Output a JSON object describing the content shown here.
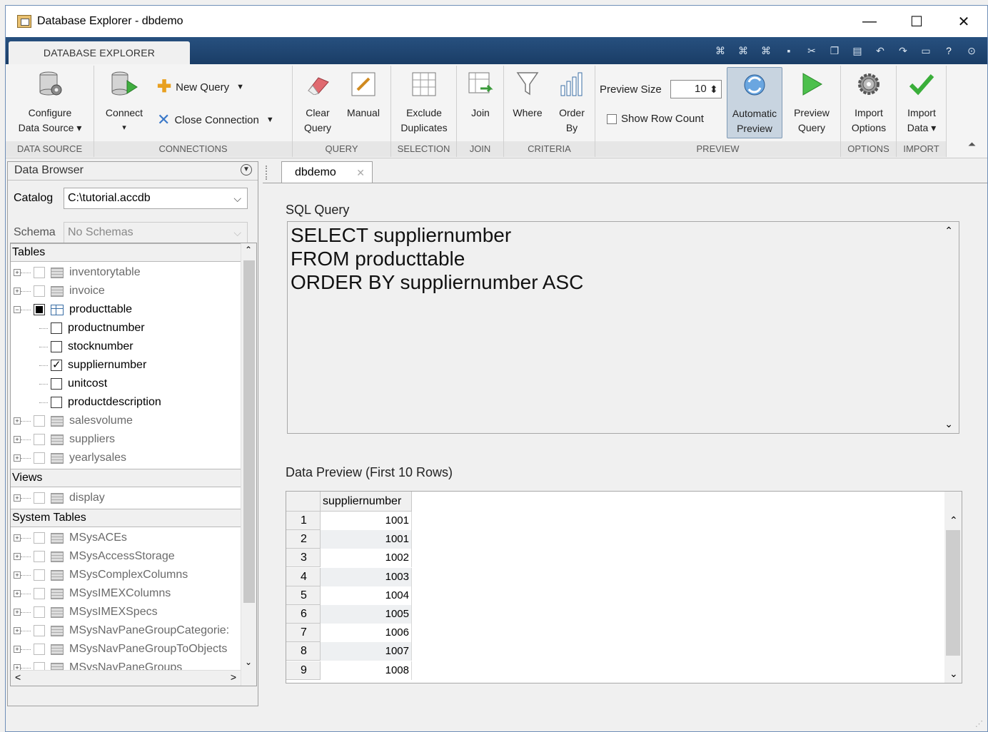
{
  "window": {
    "title": "Database Explorer - dbdemo",
    "controls": [
      "—",
      "☐",
      "✕"
    ]
  },
  "ribbon": {
    "tab": "DATABASE EXPLORER",
    "qat_icons": [
      "pin-icon",
      "pin-icon",
      "pin-icon",
      "save-icon",
      "cut-icon",
      "copy-icon",
      "paste-icon",
      "undo-icon",
      "redo-icon",
      "window-icon",
      "help-icon",
      "minimize-ribbon-icon"
    ],
    "groups": {
      "data_source": "DATA SOURCE",
      "connections": "CONNECTIONS",
      "query": "QUERY",
      "selection": "SELECTION",
      "join": "JOIN",
      "criteria": "CRITERIA",
      "preview": "PREVIEW",
      "options": "OPTIONS",
      "import": "IMPORT"
    },
    "buttons": {
      "configure_1": "Configure",
      "configure_2": "Data Source ▾",
      "connect": "Connect",
      "connect_arrow": "▾",
      "new_query": "New Query",
      "close_connection": "Close Connection",
      "clear_1": "Clear",
      "clear_2": "Query",
      "manual": "Manual",
      "exclude_1": "Exclude",
      "exclude_2": "Duplicates",
      "join": "Join",
      "where": "Where",
      "order_1": "Order",
      "order_2": "By",
      "preview_size_label": "Preview Size",
      "preview_size_value": "10",
      "show_row_count": "Show Row Count",
      "auto_1": "Automatic",
      "auto_2": "Preview",
      "preview_q_1": "Preview",
      "preview_q_2": "Query",
      "import_opts_1": "Import",
      "import_opts_2": "Options",
      "import_data_1": "Import",
      "import_data_2": "Data ▾"
    },
    "accent": "#1f4a78"
  },
  "browser": {
    "title": "Data Browser",
    "catalog_label": "Catalog",
    "catalog_value": "C:\\tutorial.accdb",
    "schema_label": "Schema",
    "schema_value": "No Schemas",
    "sections": {
      "tables": "Tables",
      "views": "Views",
      "system": "System Tables"
    },
    "tables": [
      "inventorytable",
      "invoice",
      "producttable",
      "salesvolume",
      "suppliers",
      "yearlysales"
    ],
    "columns": [
      "productnumber",
      "stocknumber",
      "suppliernumber",
      "unitcost",
      "productdescription"
    ],
    "checked_column": "suppliernumber",
    "views": [
      "display"
    ],
    "system_tables": [
      "MSysACEs",
      "MSysAccessStorage",
      "MSysComplexColumns",
      "MSysIMEXColumns",
      "MSysIMEXSpecs",
      "MSysNavPaneGroupCategorie:",
      "MSysNavPaneGroupToObjects",
      "MSysNavPaneGroups"
    ]
  },
  "doc": {
    "tab": "dbdemo",
    "sql_label": "SQL Query",
    "sql_lines": [
      "SELECT suppliernumber",
      "FROM producttable",
      "ORDER BY suppliernumber ASC"
    ],
    "preview_label": "Data Preview (First 10 Rows)",
    "column": "suppliernumber",
    "rows": [
      [
        "1",
        "1001"
      ],
      [
        "2",
        "1001"
      ],
      [
        "3",
        "1002"
      ],
      [
        "4",
        "1003"
      ],
      [
        "5",
        "1004"
      ],
      [
        "6",
        "1005"
      ],
      [
        "7",
        "1006"
      ],
      [
        "8",
        "1007"
      ],
      [
        "9",
        "1008"
      ]
    ]
  }
}
